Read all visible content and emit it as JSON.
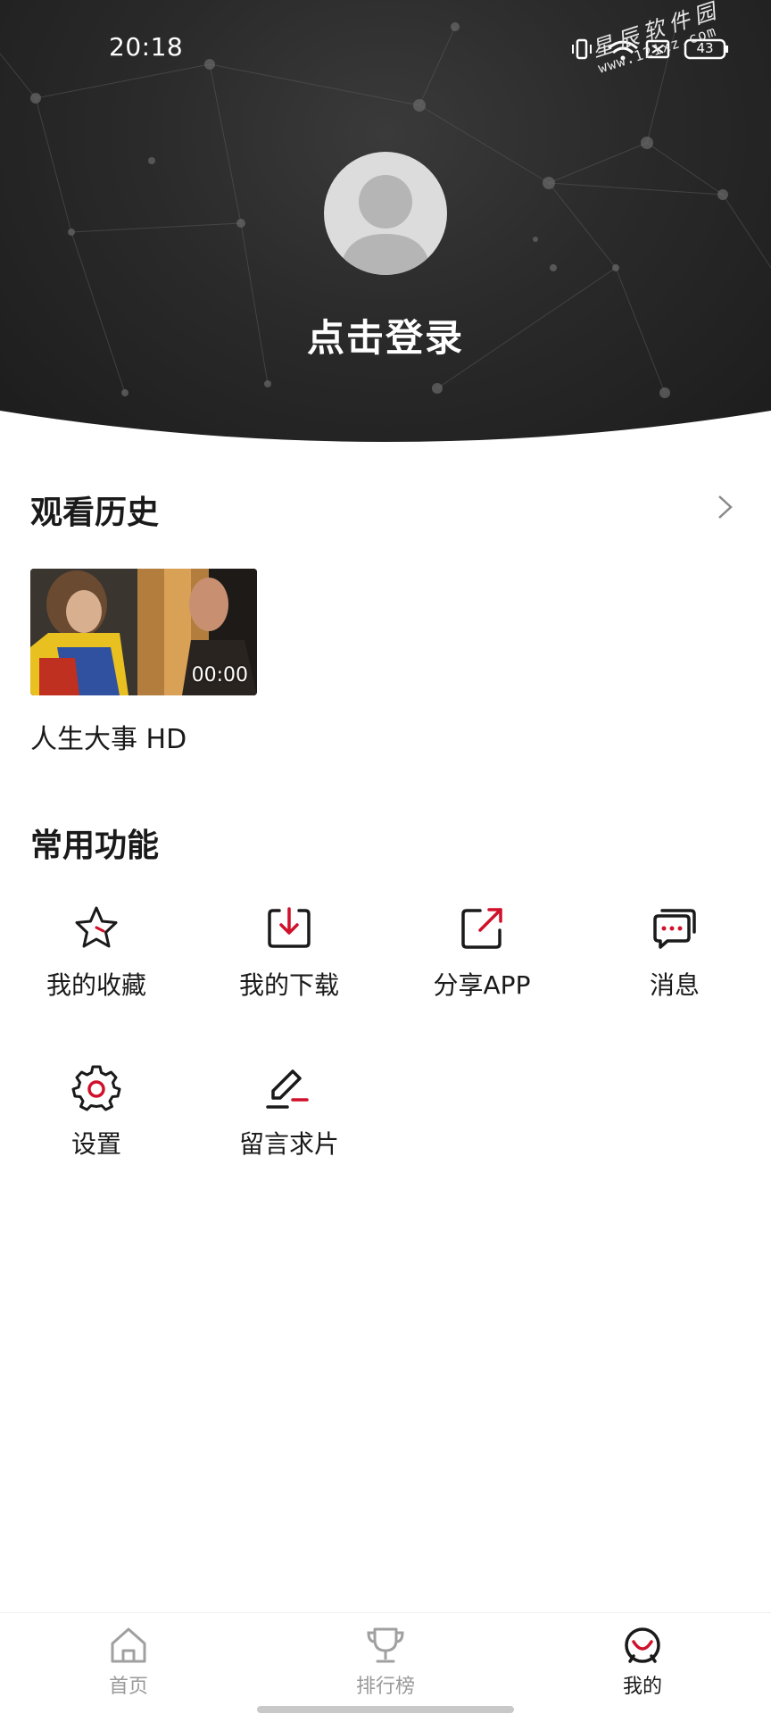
{
  "status_bar": {
    "time": "20:18",
    "battery": "43"
  },
  "watermark": {
    "name": "星辰软件园",
    "url": "www.121xz.com"
  },
  "profile": {
    "login_text": "点击登录"
  },
  "history": {
    "title": "观看历史",
    "items": [
      {
        "title": "人生大事 HD",
        "duration": "00:00"
      }
    ]
  },
  "features": {
    "title": "常用功能",
    "items": [
      {
        "label": "我的收藏",
        "icon": "star-icon"
      },
      {
        "label": "我的下载",
        "icon": "download-icon"
      },
      {
        "label": "分享APP",
        "icon": "share-icon"
      },
      {
        "label": "消息",
        "icon": "message-icon"
      },
      {
        "label": "设置",
        "icon": "gear-icon"
      },
      {
        "label": "留言求片",
        "icon": "edit-icon"
      }
    ]
  },
  "nav": {
    "items": [
      {
        "label": "首页",
        "icon": "home-icon",
        "active": false
      },
      {
        "label": "排行榜",
        "icon": "trophy-icon",
        "active": false
      },
      {
        "label": "我的",
        "icon": "profile-icon",
        "active": true
      }
    ]
  },
  "colors": {
    "accent": "#d0112b",
    "header_bg": "#2a2a2a",
    "inactive": "#9a9a9a"
  }
}
